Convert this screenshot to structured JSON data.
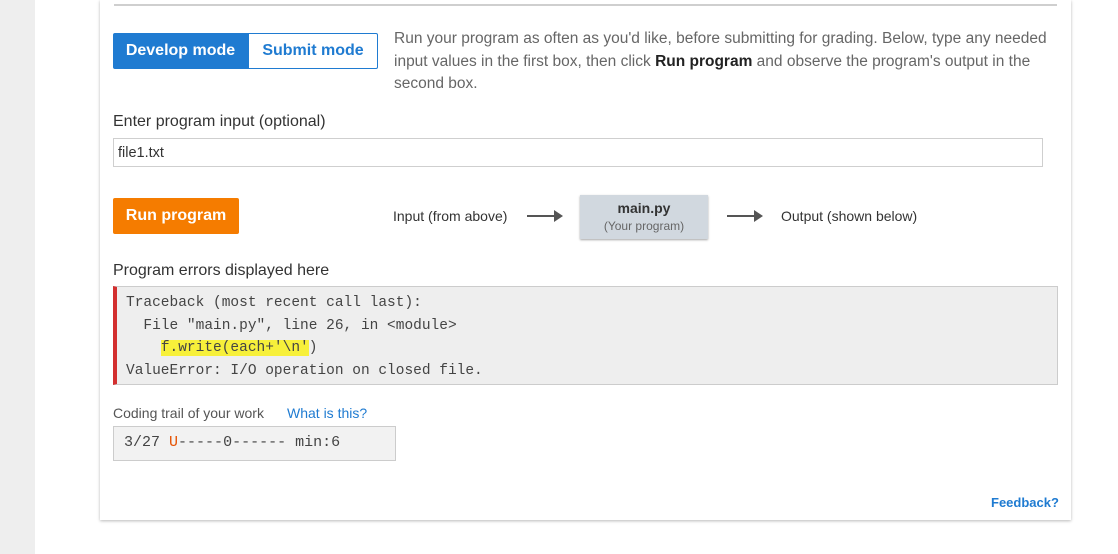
{
  "mode_toggle": {
    "develop_label": "Develop mode",
    "submit_label": "Submit mode",
    "active": "develop"
  },
  "instructions": {
    "part1": "Run your program as often as you'd like, before submitting for grading. Below, type any needed input values in the first box, then click ",
    "bold": "Run program",
    "part2": " and observe the program's output in the second box."
  },
  "program_input": {
    "label": "Enter program input (optional)",
    "value": "file1.txt"
  },
  "run_button": {
    "label": "Run program"
  },
  "flow": {
    "input_label": "Input (from above)",
    "program_name": "main.py",
    "program_sub": "(Your program)",
    "output_label": "Output (shown below)"
  },
  "errors": {
    "label": "Program errors displayed here",
    "line1": "Traceback (most recent call last):",
    "line2": "  File \"main.py\", line 26, in <module>",
    "line3_indent": "    ",
    "line3_code": "f.write(each+'\\n'",
    "line3_rest": ")",
    "line4": "ValueError: I/O operation on closed file."
  },
  "coding_trail": {
    "label": "Coding trail of your work",
    "help_link": "What is this?",
    "date": "3/27",
    "marker": "U",
    "dashes1": "-----",
    "zero": "0",
    "dashes2": "------",
    "min": "min:6"
  },
  "feedback": {
    "label": "Feedback?"
  },
  "colors": {
    "accent_blue": "#1f7bd1",
    "run_orange": "#f57c00",
    "error_red": "#d32f2f",
    "highlight_yellow": "#f7f03a"
  }
}
